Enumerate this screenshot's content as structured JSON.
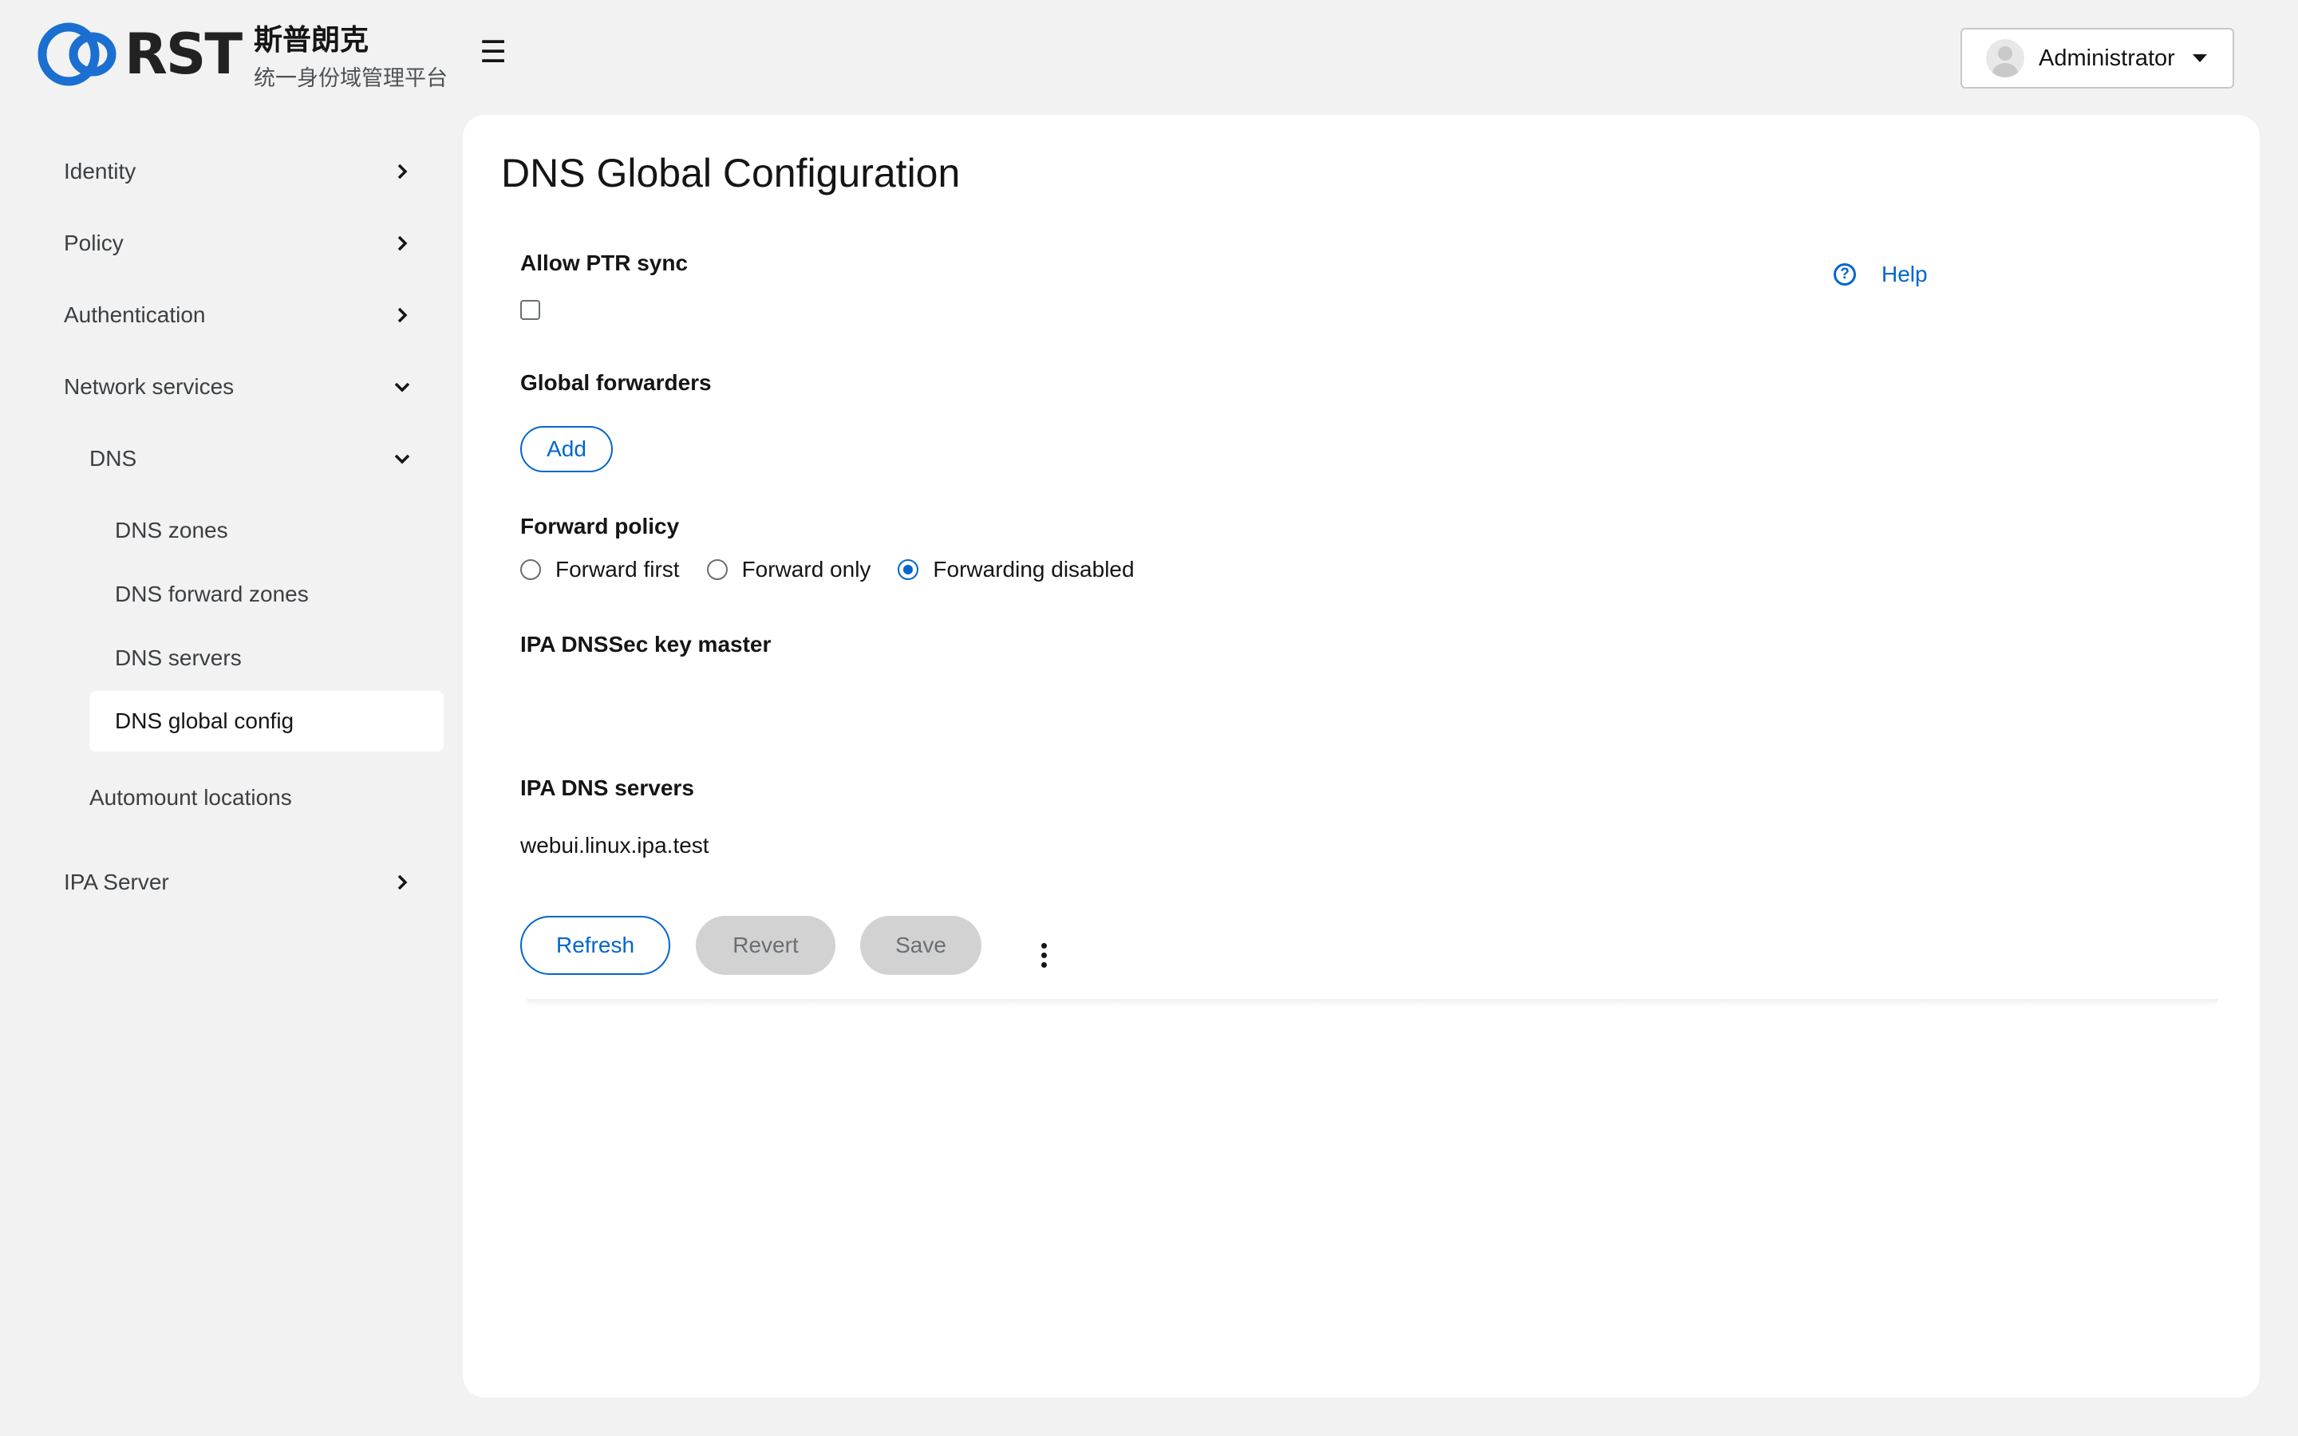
{
  "header": {
    "logo_text": "RST",
    "brand_title": "斯普朗克",
    "brand_subtitle": "统一身份域管理平台",
    "menu_toggle_glyph": "☰",
    "user_name": "Administrator"
  },
  "sidebar": {
    "items": [
      {
        "label": "Identity"
      },
      {
        "label": "Policy"
      },
      {
        "label": "Authentication"
      },
      {
        "label": "Network services"
      },
      {
        "label": "DNS"
      },
      {
        "label": "DNS zones"
      },
      {
        "label": "DNS forward zones"
      },
      {
        "label": "DNS servers"
      },
      {
        "label": "DNS global config"
      },
      {
        "label": "Automount locations"
      },
      {
        "label": "IPA Server"
      }
    ]
  },
  "main": {
    "title": "DNS Global Configuration",
    "help_label": "Help",
    "allow_ptr_sync": {
      "label": "Allow PTR sync",
      "checked": false
    },
    "global_forwarders": {
      "label": "Global forwarders",
      "add_label": "Add"
    },
    "forward_policy": {
      "label": "Forward policy",
      "options": [
        "Forward first",
        "Forward only",
        "Forwarding disabled"
      ],
      "selected": "Forwarding disabled"
    },
    "dnssec_key_master": {
      "label": "IPA DNSSec key master",
      "value": ""
    },
    "dns_servers": {
      "label": "IPA DNS servers",
      "value": "webui.linux.ipa.test"
    },
    "actions": {
      "refresh": "Refresh",
      "revert": "Revert",
      "save": "Save"
    }
  },
  "colors": {
    "accent": "#0066cc",
    "page_bg": "#f2f2f2",
    "card_bg": "#ffffff",
    "disabled_bg": "#d2d2d2"
  },
  "icons": {
    "logo": "rst-logo-icon",
    "menu": "hamburger-icon",
    "avatar": "user-avatar-icon",
    "dropdown": "caret-down-icon",
    "collapsed": "chevron-right-icon",
    "expanded": "chevron-down-icon",
    "help": "question-circle-icon",
    "more": "kebab-icon"
  }
}
